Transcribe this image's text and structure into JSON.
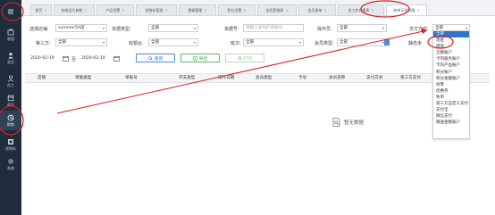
{
  "sidebar": {
    "items": [
      {
        "label": "",
        "icon": "menu-icon"
      },
      {
        "label": "收银",
        "icon": "cashier-icon"
      },
      {
        "label": "会员",
        "icon": "member-icon"
      },
      {
        "label": "员工",
        "icon": "staff-icon"
      },
      {
        "label": "商品",
        "icon": "goods-icon"
      },
      {
        "label": "财务",
        "icon": "finance-icon"
      },
      {
        "label": "进销存",
        "icon": "inventory-icon"
      },
      {
        "label": "系统",
        "icon": "system-icon"
      }
    ]
  },
  "tabs": [
    {
      "label": "首页"
    },
    {
      "label": "系统运行参数"
    },
    {
      "label": "产品设置"
    },
    {
      "label": "进销存管理"
    },
    {
      "label": "票据管理"
    },
    {
      "label": "积分设置"
    },
    {
      "label": "会员套餐表"
    },
    {
      "label": "会员清单"
    },
    {
      "label": "员工综合报表"
    },
    {
      "label": "收单记录明细"
    }
  ],
  "filters": {
    "store_label": "选择店铺:",
    "store_value": "summer5A店",
    "doc_type_label": "单据类型:",
    "doc_type_value": "全部",
    "doc_no_label": "单据号:",
    "doc_no_placeholder": "请输入查询的单据号",
    "operator_label": "操作员:",
    "operator_value": "全部",
    "pay_method_label": "支付方式:",
    "pay_method_value": "全部",
    "third_party_label": "第三方:",
    "third_party_value": "全部",
    "cashier_label": "收银台:",
    "cashier_value": "全部",
    "shift_label": "班次:",
    "shift_value": "全部",
    "member_type_label": "会员类型:",
    "member_type_value": "全部",
    "static_label": "静态未",
    "date_from": "2020-02-19",
    "date_to_label": "至",
    "date_to": "2020-02-19"
  },
  "buttons": {
    "query": "查询",
    "export": "导出",
    "print": "打印"
  },
  "table": {
    "columns": [
      "店铺",
      "单据类型",
      "单据号",
      "开支类型",
      "操作日期",
      "会员类型",
      "卡号",
      "会员名称",
      "支付方式",
      "第三方支付"
    ],
    "empty_text": "暂无数据"
  },
  "dropdown": {
    "options": [
      "全部",
      "现金",
      "储值",
      "全额账户",
      "卡内服务账户",
      "卡内产品账户",
      "积分账户",
      "积分金额账户",
      "找零",
      "优惠券",
      "免单",
      "第三方自定义支付",
      "支付宝",
      "微信支付",
      "赠送金额账户"
    ],
    "selected_index": 0
  },
  "colors": {
    "sidebar_bg": "#1f2d3d",
    "accent": "#2f74c8",
    "annotation_red": "#d42020"
  }
}
